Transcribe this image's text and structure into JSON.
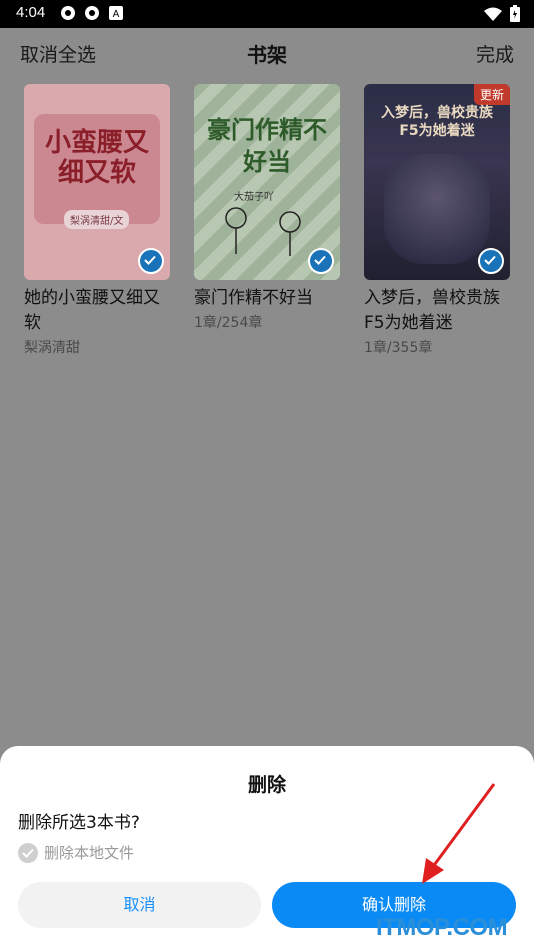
{
  "status_bar": {
    "time": "4:04"
  },
  "header": {
    "left": "取消全选",
    "title": "书架",
    "right": "完成"
  },
  "books": [
    {
      "title": "她的小蛮腰又细又软",
      "subtitle": "梨涡清甜",
      "cover_text": "小蛮腰又细又软",
      "cover_author": "梨涡清甜/文",
      "selected": true
    },
    {
      "title": "豪门作精不好当",
      "subtitle": "1章/254章",
      "cover_text": "豪门作精不好当",
      "cover_author": "大茄子吖",
      "selected": true
    },
    {
      "title": "入梦后，兽校贵族F5为她着迷",
      "subtitle": "1章/355章",
      "cover_text": "入梦后，兽校贵族F5为她着迷",
      "badge": "更新",
      "selected": true
    }
  ],
  "dialog": {
    "title": "删除",
    "message": "删除所选3本书?",
    "option_label": "删除本地文件",
    "cancel_label": "取消",
    "confirm_label": "确认删除"
  },
  "watermark": "ITMOP.COM",
  "colors": {
    "accent": "#0a8af5",
    "overlay": "#8c8c8c",
    "cancel_text": "#1890ff"
  }
}
